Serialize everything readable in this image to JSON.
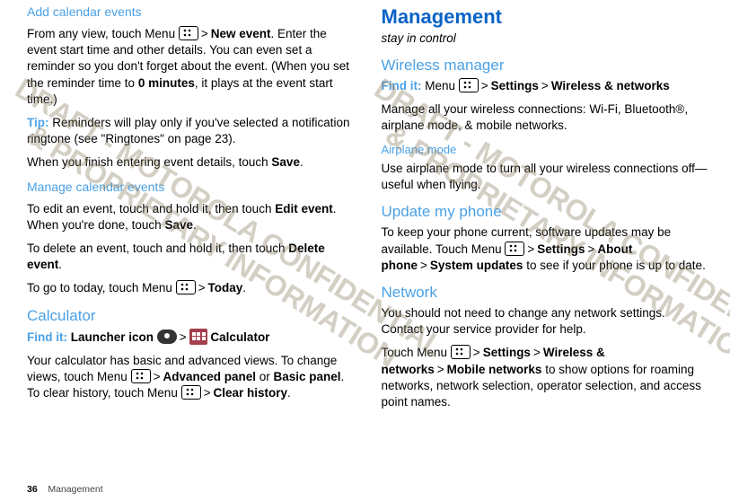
{
  "left": {
    "h1": "Add calendar events",
    "p1a": "From any view, touch Menu ",
    "p1b": "New event",
    "p1c": ". Enter the event start time and other details. You can even set a reminder so you don't forget about the event. (When you set the reminder time to ",
    "p1d": "0 minutes",
    "p1e": ", it plays at the event start time.)",
    "tip_label": "Tip:",
    "tip_text": " Reminders will play only if you've selected a notification ringtone (see \"Ringtones\" on page 23).",
    "p2a": "When you finish entering event details, touch ",
    "p2b": "Save",
    "p2c": ".",
    "h2": "Manage calendar events",
    "p3a": "To edit an event, touch and hold it, then touch ",
    "p3b": "Edit event",
    "p3c": ". When you're done, touch ",
    "p3d": "Save",
    "p3e": ".",
    "p4a": "To delete an event, touch and hold it, then touch ",
    "p4b": "Delete event",
    "p4c": ".",
    "p5a": "To go to today, touch Menu ",
    "p5b": "Today",
    "p5c": ".",
    "h3": "Calculator",
    "findit": "Find it:",
    "fi1a": " Launcher icon ",
    "fi1b": "Calculator",
    "p6": "Your calculator has basic and advanced views. To change views, touch Menu ",
    "p6b": "Advanced panel",
    "p6c": " or ",
    "p6d": "Basic panel",
    "p6e": ". To clear history, touch Menu ",
    "p6f": "Clear history",
    "p6g": "."
  },
  "right": {
    "h1": "Management",
    "sub": "stay in control",
    "h2": "Wireless manager",
    "findit": "Find it:",
    "fi_menu": " Menu ",
    "fi_settings": "Settings",
    "fi_wireless": "Wireless & networks",
    "p1": "Manage all your wireless connections: Wi-Fi, Bluetooth®, airplane mode, & mobile networks.",
    "h3": "Airplane mode",
    "p2": "Use airplane mode to turn all your wireless connections off—useful when flying.",
    "h4": "Update my phone",
    "p3a": "To keep your phone current, software updates may be available. Touch Menu ",
    "p3b": "Settings",
    "p3c": "About phone",
    "p3d": "System updates",
    "p3e": " to see if your phone is up to date.",
    "h5": "Network",
    "p4": "You should not need to change any network settings. Contact your service provider for help.",
    "p5a": "Touch Menu ",
    "p5b": "Settings",
    "p5c": "Wireless & networks",
    "p5d": "Mobile networks",
    "p5e": " to show options for roaming networks, network selection, operator selection, and access point names."
  },
  "watermark_l1": "DRAFT - MOTOROLA CONFIDENTIAL",
  "watermark_l2": "& PROPRIETARY INFORMATION",
  "footer_page": "36",
  "footer_label": "Management",
  "gt": ">"
}
